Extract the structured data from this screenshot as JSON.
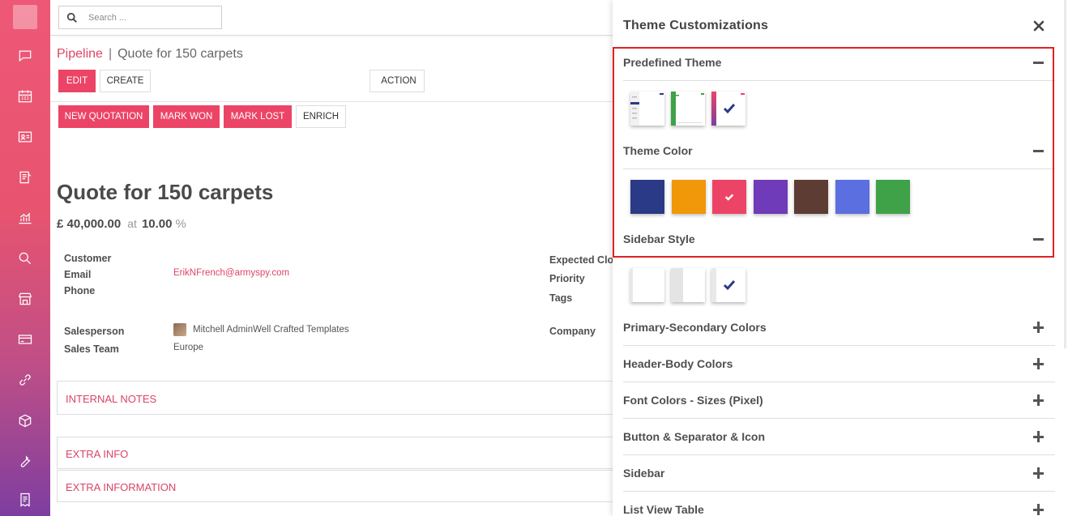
{
  "search": {
    "placeholder": "Search ..."
  },
  "breadcrumb": {
    "parent": "Pipeline",
    "separator": "|",
    "current": "Quote for 150 carpets"
  },
  "toolbar": {
    "edit_label": "EDIT",
    "create_label": "CREATE",
    "action_label": "ACTION"
  },
  "statusbar": {
    "new_quotation": "NEW QUOTATION",
    "mark_won": "MARK WON",
    "mark_lost": "MARK LOST",
    "enrich": "ENRICH"
  },
  "record": {
    "title": "Quote for 150 carpets",
    "amount": "£ 40,000.00",
    "at": "at",
    "probability": "10.00",
    "percent": "%"
  },
  "fields": {
    "customer_label": "Customer",
    "email_label": "Email",
    "email_value": "ErikNFrench@armyspy.com",
    "phone_label": "Phone",
    "expected_closing_label": "Expected Clos",
    "priority_label": "Priority",
    "tags_label": "Tags",
    "salesperson_label": "Salesperson",
    "salesperson_value": "Mitchell AdminWell Crafted Templates",
    "sales_team_label": "Sales Team",
    "sales_team_value": "Europe",
    "company_label": "Company"
  },
  "sections": {
    "internal_notes": "INTERNAL NOTES",
    "extra_info": "EXTRA INFO",
    "extra_information": "EXTRA INFORMATION"
  },
  "panel": {
    "title": "Theme Customizations",
    "predefined_theme": "Predefined Theme",
    "theme_color": "Theme Color",
    "sidebar_style": "Sidebar Style",
    "collapsed_sections": [
      "Primary-Secondary Colors",
      "Header-Body Colors",
      "Font Colors - Sizes (Pixel)",
      "Button & Separator & Icon",
      "Sidebar",
      "List View Table"
    ],
    "theme_colors": [
      "#2b3a86",
      "#f0980a",
      "#ec4466",
      "#6f3bb8",
      "#5d3d33",
      "#5b6fe0",
      "#3fa148"
    ],
    "selected_theme_color": 2,
    "selected_predefined_theme": 2,
    "selected_sidebar_style": 2
  },
  "colors": {
    "accent": "#ec4466",
    "check": "#2b3a86"
  }
}
